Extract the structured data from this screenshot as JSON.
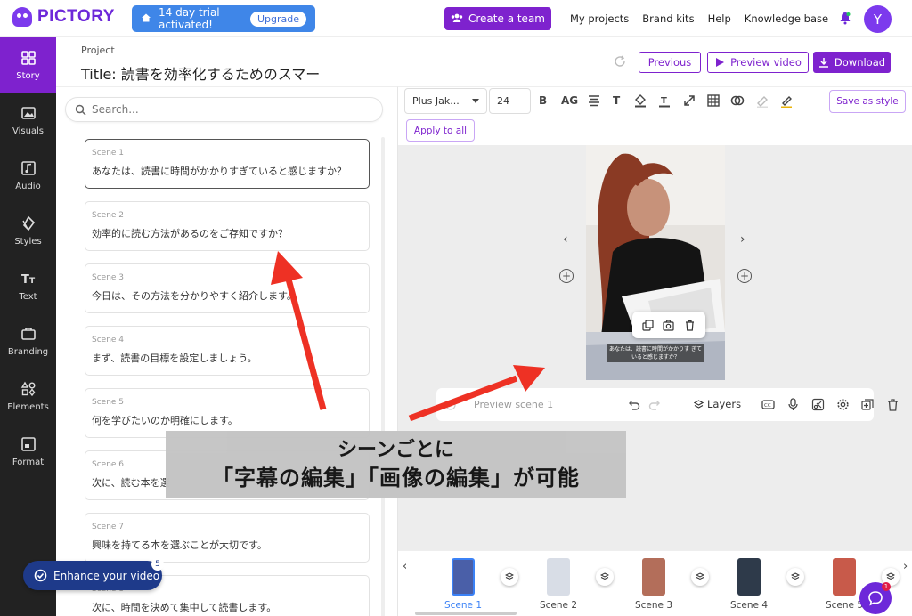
{
  "header": {
    "logo_text": "PICTORY",
    "trial_text": "14 day trial activated!",
    "upgrade_label": "Upgrade",
    "create_team_label": "Create a team",
    "nav": [
      "My projects",
      "Brand kits",
      "Help",
      "Knowledge base"
    ],
    "avatar_initial": "Y"
  },
  "sidebar": {
    "items": [
      {
        "label": "Story",
        "icon": "story-icon",
        "active": true
      },
      {
        "label": "Visuals",
        "icon": "image-icon"
      },
      {
        "label": "Audio",
        "icon": "music-icon"
      },
      {
        "label": "Styles",
        "icon": "styles-icon"
      },
      {
        "label": "Text",
        "icon": "text-icon"
      },
      {
        "label": "Branding",
        "icon": "briefcase-icon"
      },
      {
        "label": "Elements",
        "icon": "elements-icon"
      },
      {
        "label": "Format",
        "icon": "format-icon"
      }
    ]
  },
  "project": {
    "label": "Project",
    "title": "Title: 読書を効率化するためのスマー",
    "previous_label": "Previous",
    "preview_label": "Preview video",
    "download_label": "Download"
  },
  "search": {
    "placeholder": "Search..."
  },
  "scenes": [
    {
      "num": "Scene 1",
      "text": "あなたは、読書に時間がかかりすぎていると感じますか？"
    },
    {
      "num": "Scene 2",
      "text": "効率的に読む方法があるのをご存知ですか？"
    },
    {
      "num": "Scene 3",
      "text": "今日は、その方法を分かりやすく紹介します。"
    },
    {
      "num": "Scene 4",
      "text": "まず、読書の目標を設定しましょう。"
    },
    {
      "num": "Scene 5",
      "text": "何を学びたいのか明確にします。"
    },
    {
      "num": "Scene 6",
      "text": "次に、読む本を選"
    },
    {
      "num": "Scene 7",
      "text": "興味を持てる本を選ぶことが大切です。"
    },
    {
      "num": "Scene 8",
      "text": "次に、時間を決めて集中して読書します。"
    }
  ],
  "enhance": {
    "label": "Enhance your video",
    "badge": "5"
  },
  "toolbar": {
    "font": "Plus Jak...",
    "size": "24",
    "bold": "B",
    "case": "AG",
    "text_t": "T",
    "save_style": "Save as style",
    "apply_all": "Apply to all"
  },
  "preview": {
    "subtitle": "あなたは、読書に時間がかかりす ぎていると感じますか？"
  },
  "scene_bar": {
    "placeholder": "Preview scene 1",
    "layers_label": "Layers"
  },
  "overlay": {
    "line1": "シーンごとに",
    "line2": "「字幕の編集」「画像の編集」が可能"
  },
  "timeline": {
    "labels": [
      "Scene 1",
      "Scene 2",
      "Scene 3",
      "Scene 4",
      "Scene 5"
    ]
  },
  "chat": {
    "badge": "1"
  },
  "colors": {
    "accent": "#7e22ce",
    "trial_blue": "#3f86e8",
    "sidebar_bg": "#222222",
    "arrow_red": "#ee3124"
  }
}
